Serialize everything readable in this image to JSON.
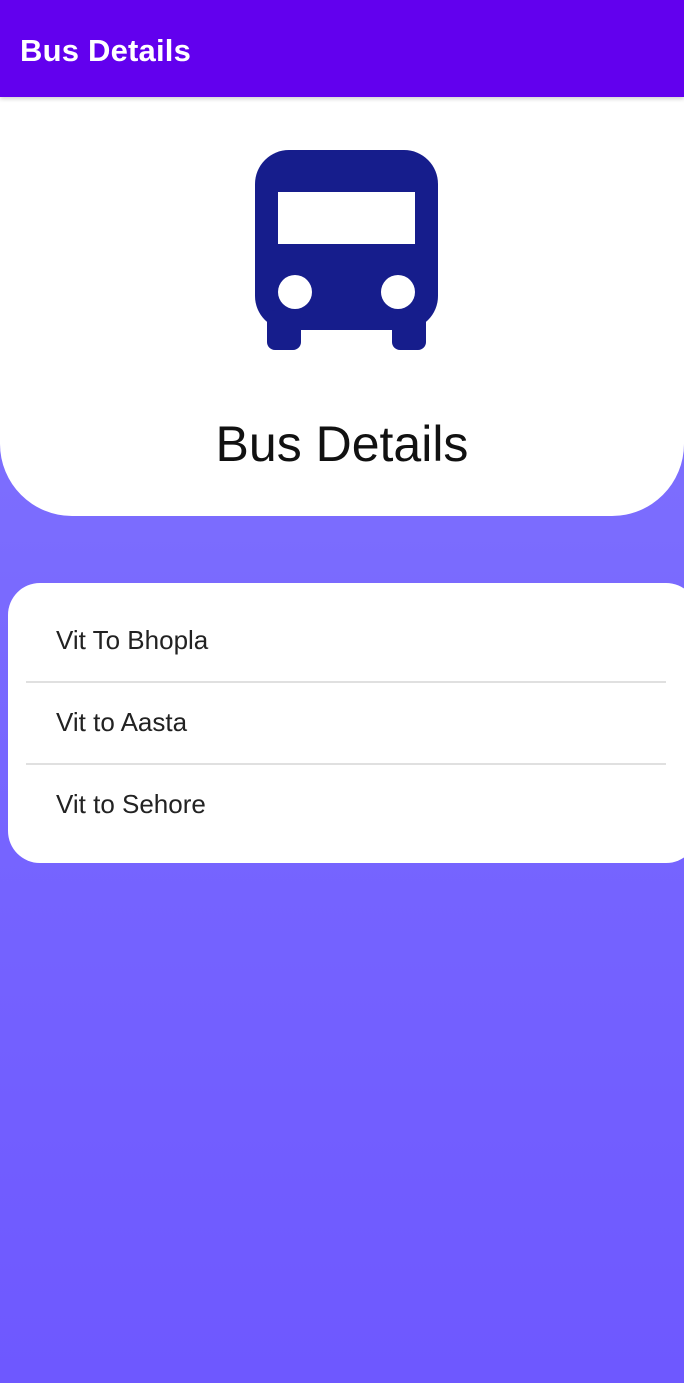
{
  "app_bar": {
    "title": "Bus Details"
  },
  "header": {
    "icon": "bus-icon",
    "title": "Bus Details"
  },
  "routes": [
    {
      "label": "Vit To Bhopla"
    },
    {
      "label": "Vit to Aasta"
    },
    {
      "label": "Vit to Sehore"
    }
  ],
  "colors": {
    "app_bar": "#6200ee",
    "icon": "#161d8c",
    "background_top": "#8479fb",
    "background_bottom": "#6e58ff"
  }
}
